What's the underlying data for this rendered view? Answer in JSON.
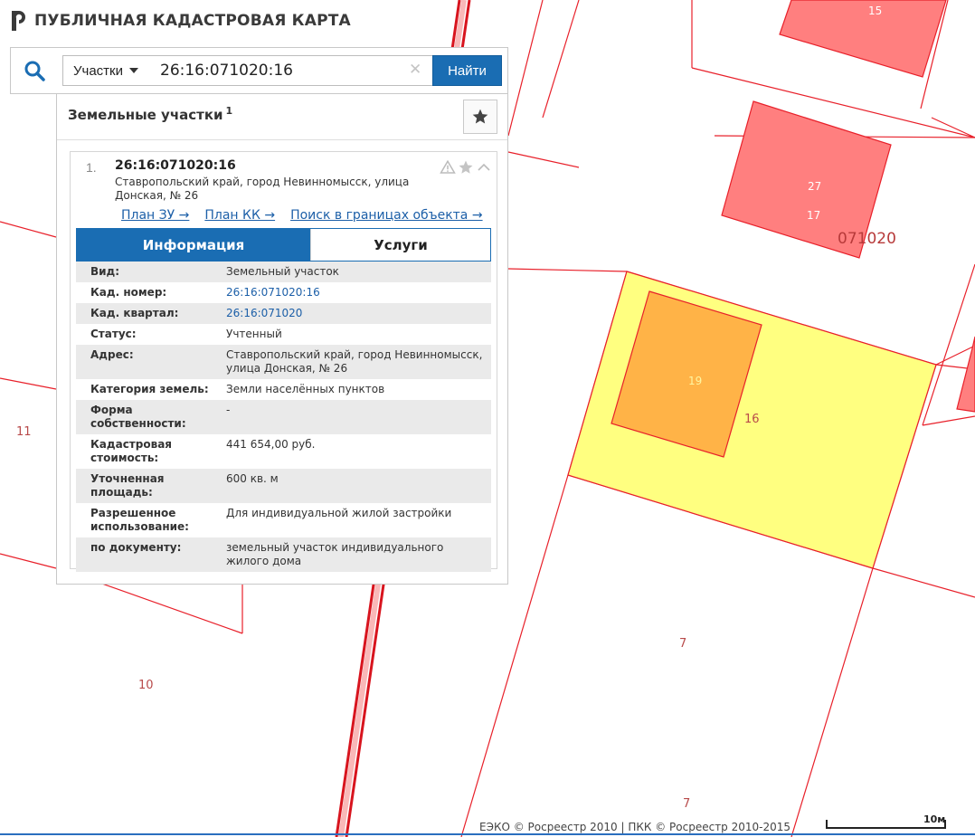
{
  "app": {
    "title": "ПУБЛИЧНАЯ КАДАСТРОВАЯ КАРТА"
  },
  "search": {
    "type_label": "Участки",
    "query": "26:16:071020:16",
    "find_label": "Найти"
  },
  "panel": {
    "title": "Земельные участки",
    "count": "1"
  },
  "result": {
    "index": "1.",
    "number": "26:16:071020:16",
    "address": "Ставропольский край, город Невинномысск, улица Донская, № 26",
    "links": [
      {
        "label": "План ЗУ →"
      },
      {
        "label": "План КК →"
      },
      {
        "label": "Поиск в границах объекта →"
      }
    ],
    "tabs": {
      "info": "Информация",
      "services": "Услуги"
    },
    "rows": [
      {
        "key": "Вид:",
        "value": "Земельный участок"
      },
      {
        "key": "Кад. номер:",
        "value": "26:16:071020:16"
      },
      {
        "key": "Кад. квартал:",
        "value": "26:16:071020"
      },
      {
        "key": "Статус:",
        "value": "Учтенный"
      },
      {
        "key": "Адрес:",
        "value": "Ставропольский край, город Невинномысск, улица Донская, № 26"
      },
      {
        "key": "Категория земель:",
        "value": "Земли населённых пунктов"
      },
      {
        "key": "Форма собственности:",
        "value": "-"
      },
      {
        "key": "Кадастровая стоимость:",
        "value": "441 654,00 руб."
      },
      {
        "key": "Уточненная площадь:",
        "value": "600 кв. м"
      },
      {
        "key": "Разрешенное использование:",
        "value": "Для индивидуальной жилой застройки"
      },
      {
        "key": "по документу:",
        "value": "земельный участок индивидуального жилого дома"
      }
    ]
  },
  "map": {
    "labels": {
      "l11": "11",
      "l10": "10",
      "l7a": "7",
      "l7b": "7",
      "l16": "16",
      "l19": "19",
      "l27": "27",
      "l17": "17",
      "l15": "15",
      "quarter": "071020"
    },
    "colors": {
      "parcel_selected": "#ffff80",
      "building_selected": "#ffb347",
      "building": "#ff7f7f",
      "boundary": "#e8202a"
    }
  },
  "footer": {
    "copyright": "ЕЭКО © Росреестр 2010 | ПКК © Росреестр 2010-2015",
    "scale": "10м"
  }
}
